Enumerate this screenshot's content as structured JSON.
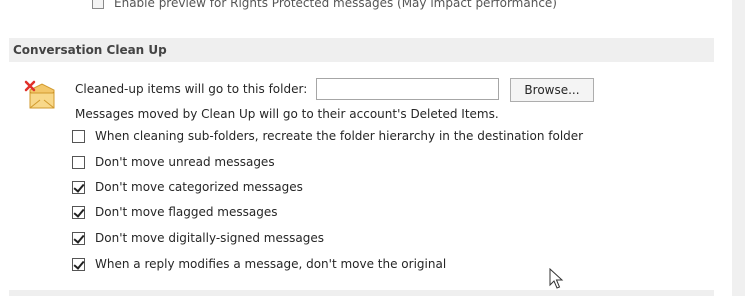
{
  "top_cut": {
    "label": "Enable preview for Rights Protected messages (May impact performance)"
  },
  "section": {
    "title": "Conversation Clean Up",
    "folder_label": "Cleaned-up items will go to this folder:",
    "folder_value": "",
    "browse_label": "Browse...",
    "info_text": "Messages moved by Clean Up will go to their account's Deleted Items."
  },
  "options": [
    {
      "label": "When cleaning sub-folders, recreate the folder hierarchy in the destination folder",
      "checked": false
    },
    {
      "label": "Don't move unread messages",
      "checked": false
    },
    {
      "label": "Don't move categorized messages",
      "checked": true
    },
    {
      "label": "Don't move flagged messages",
      "checked": true
    },
    {
      "label": "Don't move digitally-signed messages",
      "checked": true
    },
    {
      "label": "When a reply modifies a message, don't move the original",
      "checked": true
    }
  ],
  "icons": {
    "section_icon": "envelope-folder-with-red-x-icon",
    "cursor": "mouse-pointer-icon"
  }
}
